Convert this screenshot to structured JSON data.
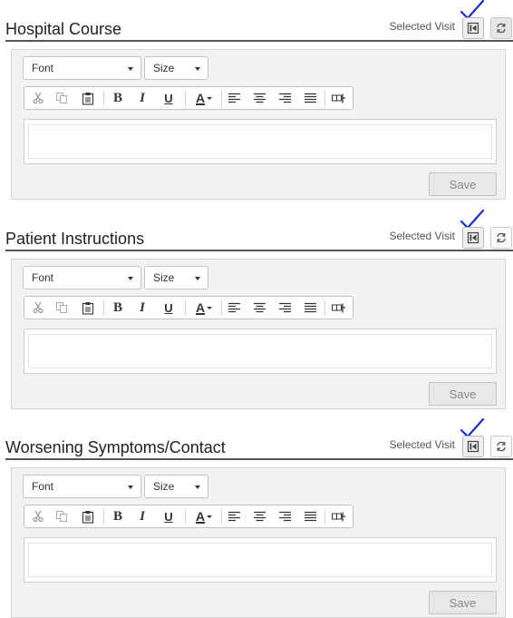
{
  "selected_visit_label": "Selected Visit",
  "font_select": {
    "value": "Font"
  },
  "size_select": {
    "value": "Size"
  },
  "save_label": "Save",
  "toolbar": {
    "buttons": [
      "cut",
      "copy",
      "paste",
      "bold",
      "italic",
      "underline",
      "text-color",
      "align-left",
      "align-center",
      "align-right",
      "justify",
      "insert-field"
    ],
    "bold_glyph": "B",
    "italic_glyph": "I",
    "underline_glyph": "U",
    "font_color_glyph": "A"
  },
  "sections": [
    {
      "title": "Hospital Course",
      "annotated_checkmark": true
    },
    {
      "title": "Patient Instructions",
      "annotated_checkmark": true
    },
    {
      "title": "Worsening Symptoms/Contact",
      "annotated_checkmark": true
    }
  ],
  "colors": {
    "checkmark": "#1a2bd6",
    "panel_bg": "#f2f2f2",
    "header_rule": "#555555",
    "save_text": "#888888"
  }
}
